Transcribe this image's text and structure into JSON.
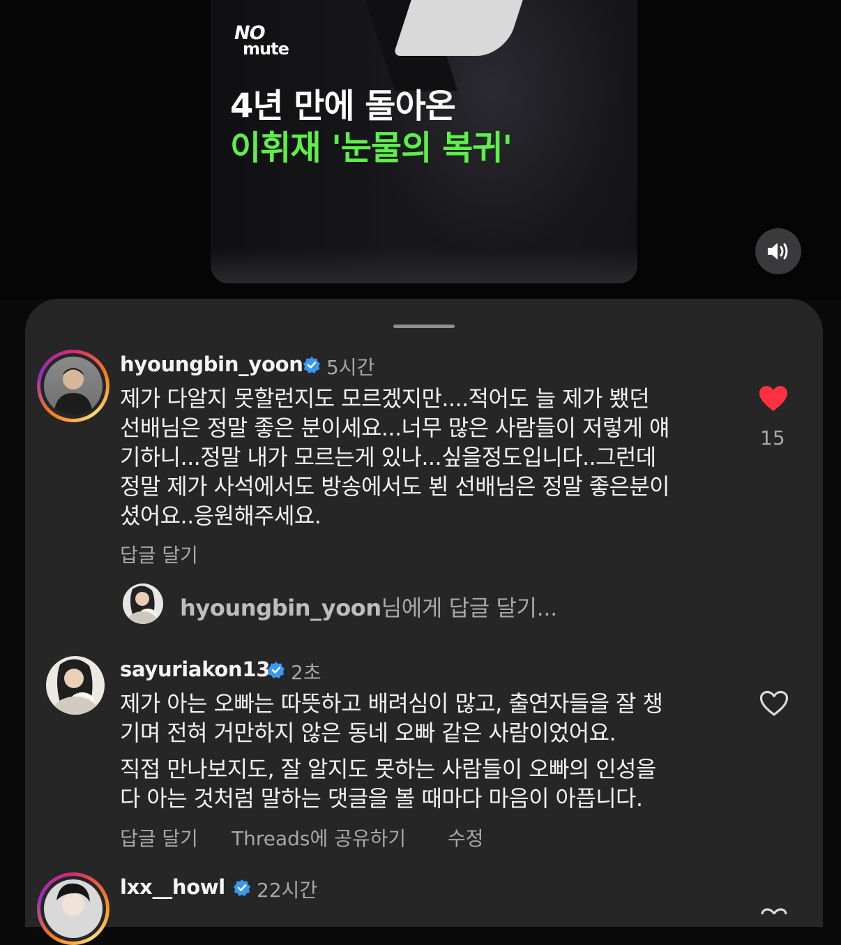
{
  "video": {
    "logo_top": "NO",
    "logo_bottom": "mute",
    "headline_line1": "4년 만에 돌아온",
    "headline_line2": "이휘재 '눈물의 복귀'",
    "sound_icon": "speaker-volume-icon"
  },
  "comments": [
    {
      "username": "hyoungbin_yoon",
      "time": "5시간",
      "text_lines": [
        "제가 다알지 못할런지도 모르겠지만....적어도 늘 제가 뵀던",
        "선배님은 정말 좋은 분이세요...너무 많은 사람들이 저렇게 얘",
        "기하니...정말 내가 모르는게 있나...싶을정도입니다..그런데",
        "정말 제가 사석에서도 방송에서도 뵌 선배님은 정말 좋은분이",
        "셨어요..응원해주세요."
      ],
      "reply_label": "답글 달기",
      "likes": "15",
      "liked": true,
      "like_color": "#ff3040"
    },
    {
      "username": "sayuriakon13",
      "time": "2초",
      "text_lines": [
        "제가 아는 오빠는 따뜻하고 배려심이 많고, 출연자들을 잘 챙",
        "기며 전혀 거만하지 않은 동네 오빠 같은 사람이었어요.",
        "직접 만나보지도, 잘 알지도 못하는 사람들이 오빠의 인성을",
        "다 아는 것처럼 말하는 댓글을 볼 때마다 마음이 아픕니다."
      ],
      "reply_label": "답글 달기",
      "share_label": "Threads에 공유하기",
      "edit_label": "수정",
      "liked": false
    },
    {
      "username": "lxx__howl",
      "time": "22시간"
    }
  ],
  "reply_box": {
    "target_user": "hyoungbin_yoon",
    "placeholder_suffix": "님에게 답글 달기..."
  },
  "colors": {
    "sheet_bg": "#262626",
    "headline_green": "#5df04a",
    "verified_blue": "#3897f0"
  }
}
